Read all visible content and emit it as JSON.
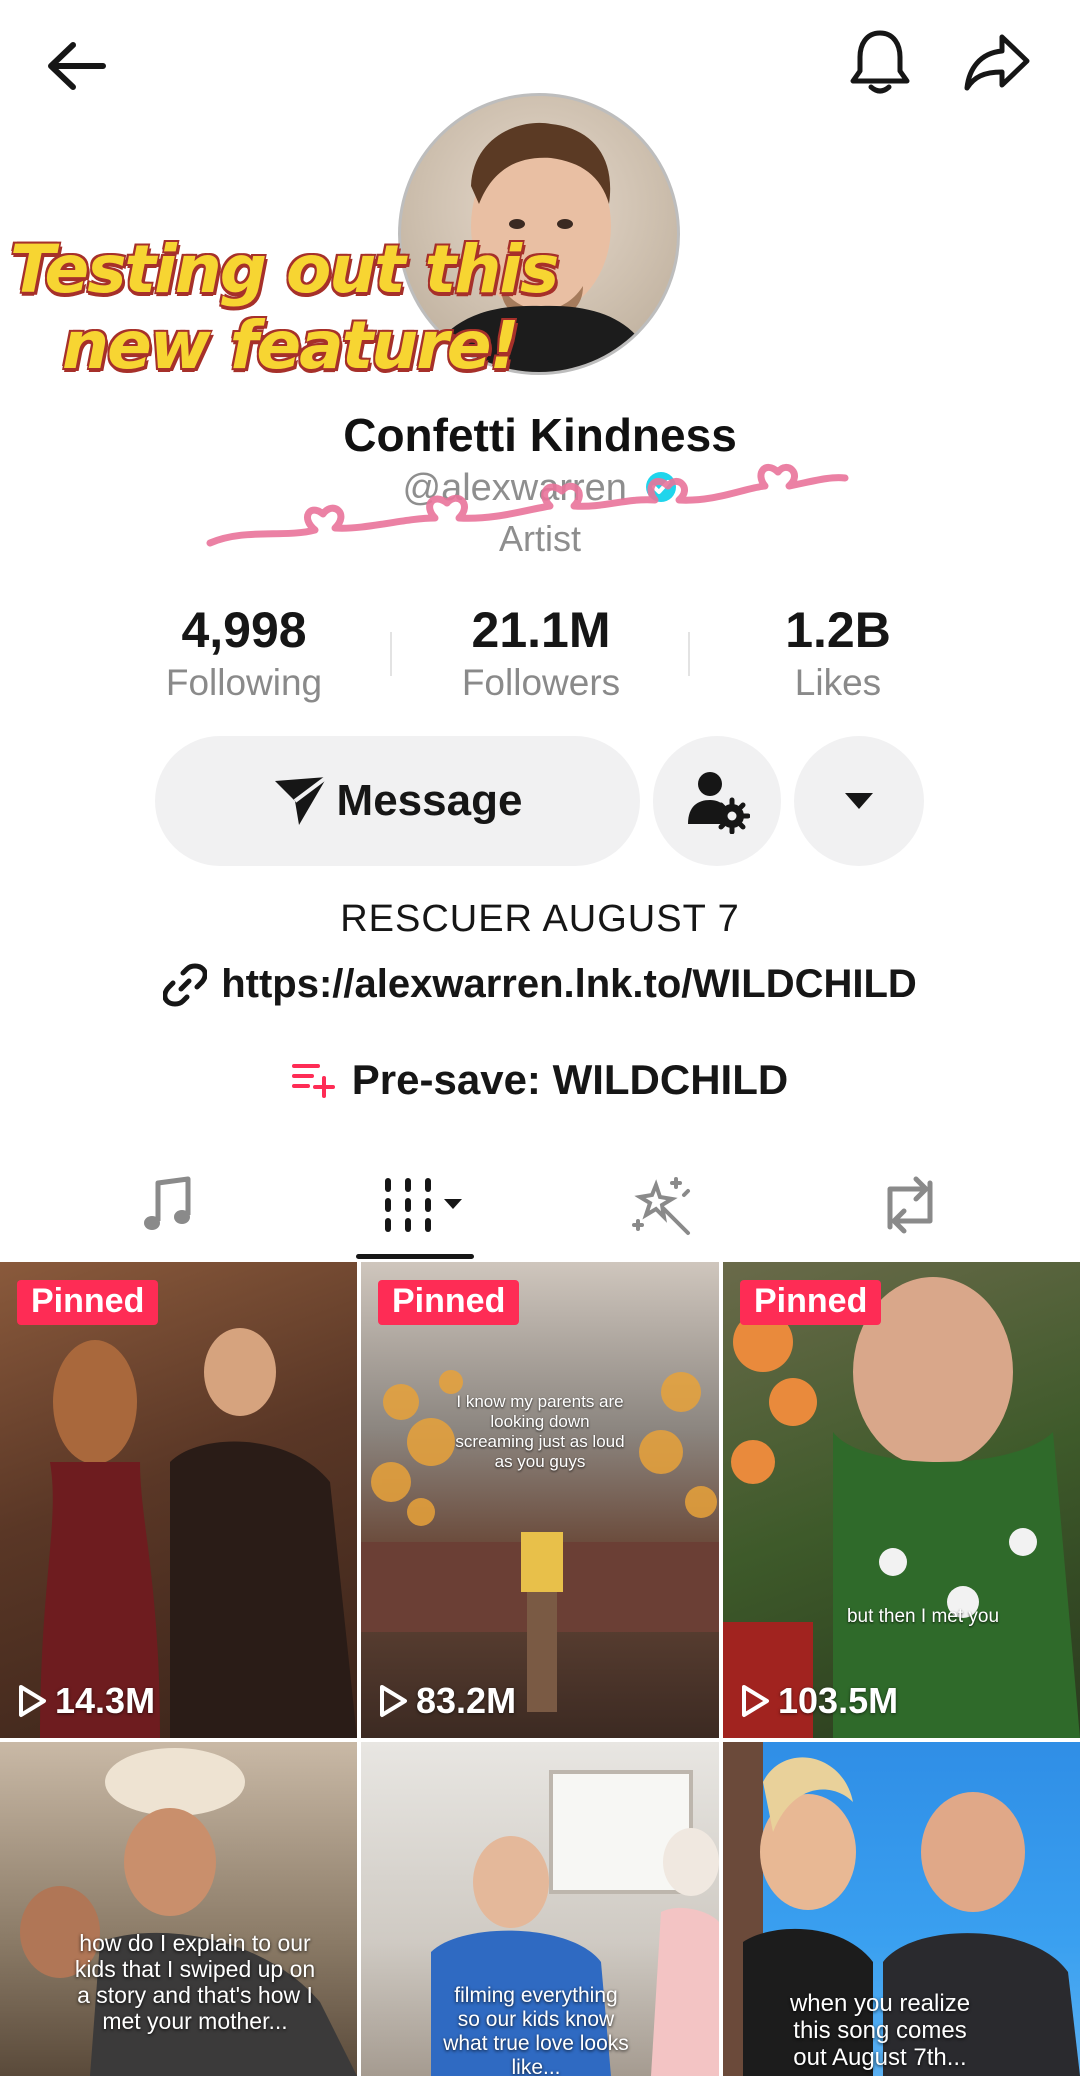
{
  "overlay": {
    "line1": "Testing out this",
    "line2": "new feature!"
  },
  "profile": {
    "name": "Confetti Kindness",
    "handle": "@alexwarren",
    "category": "Artist"
  },
  "stats": [
    {
      "value": "4,998",
      "label": "Following"
    },
    {
      "value": "21.1M",
      "label": "Followers"
    },
    {
      "value": "1.2B",
      "label": "Likes"
    }
  ],
  "actions": {
    "message_label": "Message"
  },
  "bio": {
    "text": "RESCUER AUGUST 7",
    "link": "https://alexwarren.lnk.to/WILDCHILD",
    "presave": "Pre-save: WILDCHILD"
  },
  "tabs": [
    {
      "icon": "music-note-icon"
    },
    {
      "icon": "grid-videos-icon"
    },
    {
      "icon": "sparkle-wand-icon"
    },
    {
      "icon": "repost-icon"
    }
  ],
  "videos": [
    {
      "pinned": "Pinned",
      "views": "14.3M",
      "caption": ""
    },
    {
      "pinned": "Pinned",
      "views": "83.2M",
      "caption": "I know my parents are looking down screaming just as loud as you guys"
    },
    {
      "pinned": "Pinned",
      "views": "103.5M",
      "caption": "but then I met you"
    },
    {
      "pinned": "",
      "views": "",
      "caption": "how do I explain to our kids that I swiped up on a story and that's how I met your mother..."
    },
    {
      "pinned": "",
      "views": "",
      "caption": "filming everything so our kids know what true love looks like..."
    },
    {
      "pinned": "",
      "views": "",
      "caption": "when you realize this song comes out August 7th..."
    }
  ],
  "colors": {
    "accent": "#fe2c55",
    "verified": "#20d5ec",
    "pill_bg": "#f1f1f2"
  }
}
